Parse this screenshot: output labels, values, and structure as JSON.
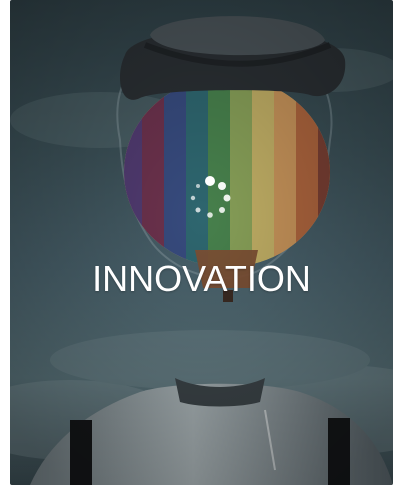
{
  "screen": {
    "title": "INNOVATION",
    "loading": true,
    "theme": {
      "overlay": "#3b5057",
      "text": "#ffffff",
      "spinner": "#ffffff"
    },
    "icons": [
      "loading-spinner-icon"
    ]
  }
}
